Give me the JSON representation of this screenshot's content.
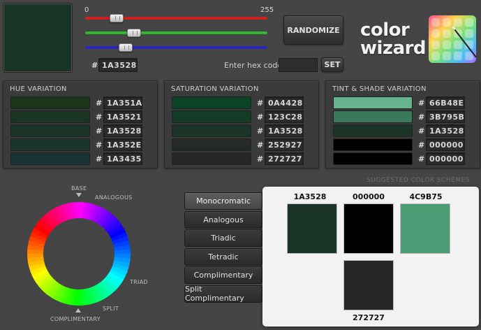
{
  "current": {
    "hex": "1A3528",
    "color": "#1A3528"
  },
  "sliders": {
    "min_label": "0",
    "max_label": "255",
    "red": {
      "value": 26,
      "color": "#d21f1f"
    },
    "green": {
      "value": 53,
      "color": "#2fb82f"
    },
    "blue": {
      "value": 40,
      "color": "#2626b8"
    }
  },
  "hash": "#",
  "hex_entry": {
    "label": "Enter hex code:",
    "value": "",
    "set_label": "SET"
  },
  "randomize_label": "RANDOMIZE",
  "logo": {
    "line1": "color",
    "line2": "wizard"
  },
  "panels": {
    "hue": {
      "title": "HUE VARIATION",
      "rows": [
        {
          "hex": "1A351A",
          "color": "#1A351A"
        },
        {
          "hex": "1A3521",
          "color": "#1A3521"
        },
        {
          "hex": "1A3528",
          "color": "#1A3528"
        },
        {
          "hex": "1A352E",
          "color": "#1A352E"
        },
        {
          "hex": "1A3435",
          "color": "#1A3435"
        }
      ]
    },
    "saturation": {
      "title": "SATURATION VARIATION",
      "rows": [
        {
          "hex": "0A4428",
          "color": "#0A4428"
        },
        {
          "hex": "123C28",
          "color": "#123C28"
        },
        {
          "hex": "1A3528",
          "color": "#1A3528"
        },
        {
          "hex": "252927",
          "color": "#252927"
        },
        {
          "hex": "272727",
          "color": "#272727"
        }
      ]
    },
    "tint": {
      "title": "TINT & SHADE VARIATION",
      "rows": [
        {
          "hex": "66B48E",
          "color": "#66B48E"
        },
        {
          "hex": "3B795B",
          "color": "#3B795B"
        },
        {
          "hex": "1A3528",
          "color": "#1A3528"
        },
        {
          "hex": "000000",
          "color": "#000000"
        },
        {
          "hex": "000000",
          "color": "#000000"
        }
      ]
    }
  },
  "suggested_title": "SUGGESTED COLOR SCHEMES",
  "wheel_labels": {
    "base": "BASE",
    "analogous": "ANALOGOUS",
    "triad": "TRIAD",
    "split": "SPLIT",
    "complimentary": "COMPLIMENTARY"
  },
  "schemes": [
    {
      "label": "Monocromatic",
      "active": true
    },
    {
      "label": "Analogous",
      "active": false
    },
    {
      "label": "Triadic",
      "active": false
    },
    {
      "label": "Tetradic",
      "active": false
    },
    {
      "label": "Complimentary",
      "active": false
    },
    {
      "label": "Split Complimentary",
      "active": false
    }
  ],
  "result_colors": [
    {
      "hex": "1A3528",
      "color": "#1A3528"
    },
    {
      "hex": "000000",
      "color": "#000000"
    },
    {
      "hex": "4C9B75",
      "color": "#4C9B75"
    },
    {
      "hex": "272727",
      "color": "#272727"
    }
  ]
}
